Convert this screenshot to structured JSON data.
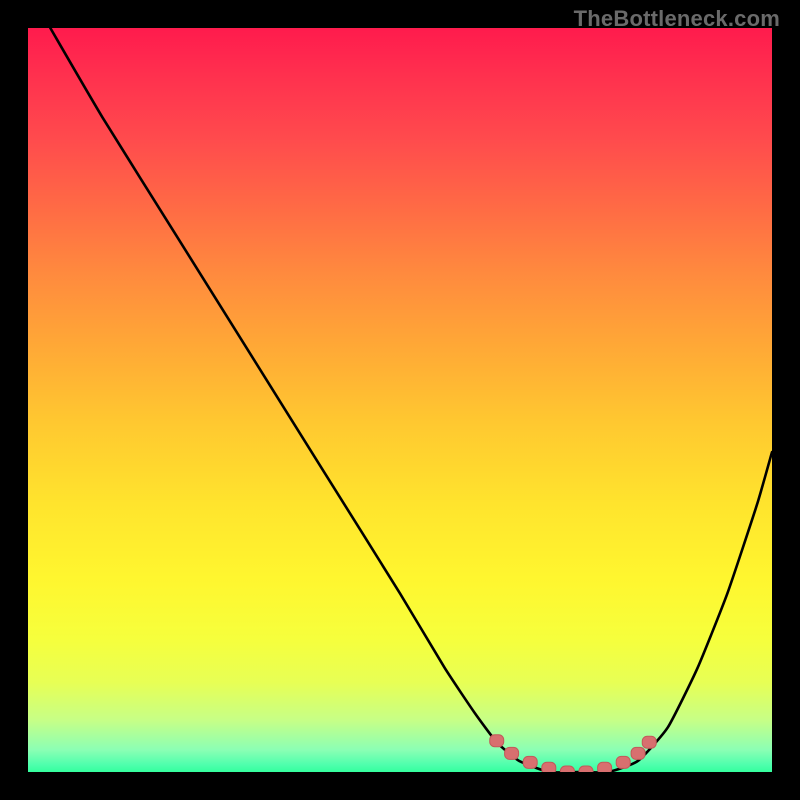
{
  "watermark": {
    "text": "TheBottleneck.com"
  },
  "colors": {
    "frame_bg": "#000000",
    "curve": "#000000",
    "marker_fill": "#d86f6f",
    "marker_stroke": "#c25a5a",
    "gradient_top": "#ff1b4d",
    "gradient_bottom": "#34ff9e"
  },
  "chart_data": {
    "type": "line",
    "title": "",
    "xlabel": "",
    "ylabel": "",
    "xlim": [
      0,
      100
    ],
    "ylim": [
      0,
      100
    ],
    "grid": false,
    "legend": false,
    "curve": {
      "name": "bottleneck-curve",
      "x": [
        3,
        10,
        20,
        30,
        40,
        50,
        56,
        60,
        63,
        66,
        70,
        74,
        78,
        82,
        86,
        90,
        94,
        98,
        100
      ],
      "y": [
        100,
        88,
        72,
        56,
        40,
        24,
        14,
        8,
        4,
        1.5,
        0,
        0,
        0,
        1.5,
        6,
        14,
        24,
        36,
        43
      ]
    },
    "markers": {
      "name": "optimal-range",
      "points": [
        {
          "x": 63,
          "y": 4.2
        },
        {
          "x": 65,
          "y": 2.5
        },
        {
          "x": 67.5,
          "y": 1.3
        },
        {
          "x": 70,
          "y": 0.5
        },
        {
          "x": 72.5,
          "y": 0
        },
        {
          "x": 75,
          "y": 0
        },
        {
          "x": 77.5,
          "y": 0.5
        },
        {
          "x": 80,
          "y": 1.3
        },
        {
          "x": 82,
          "y": 2.5
        },
        {
          "x": 83.5,
          "y": 4.0
        }
      ]
    }
  }
}
